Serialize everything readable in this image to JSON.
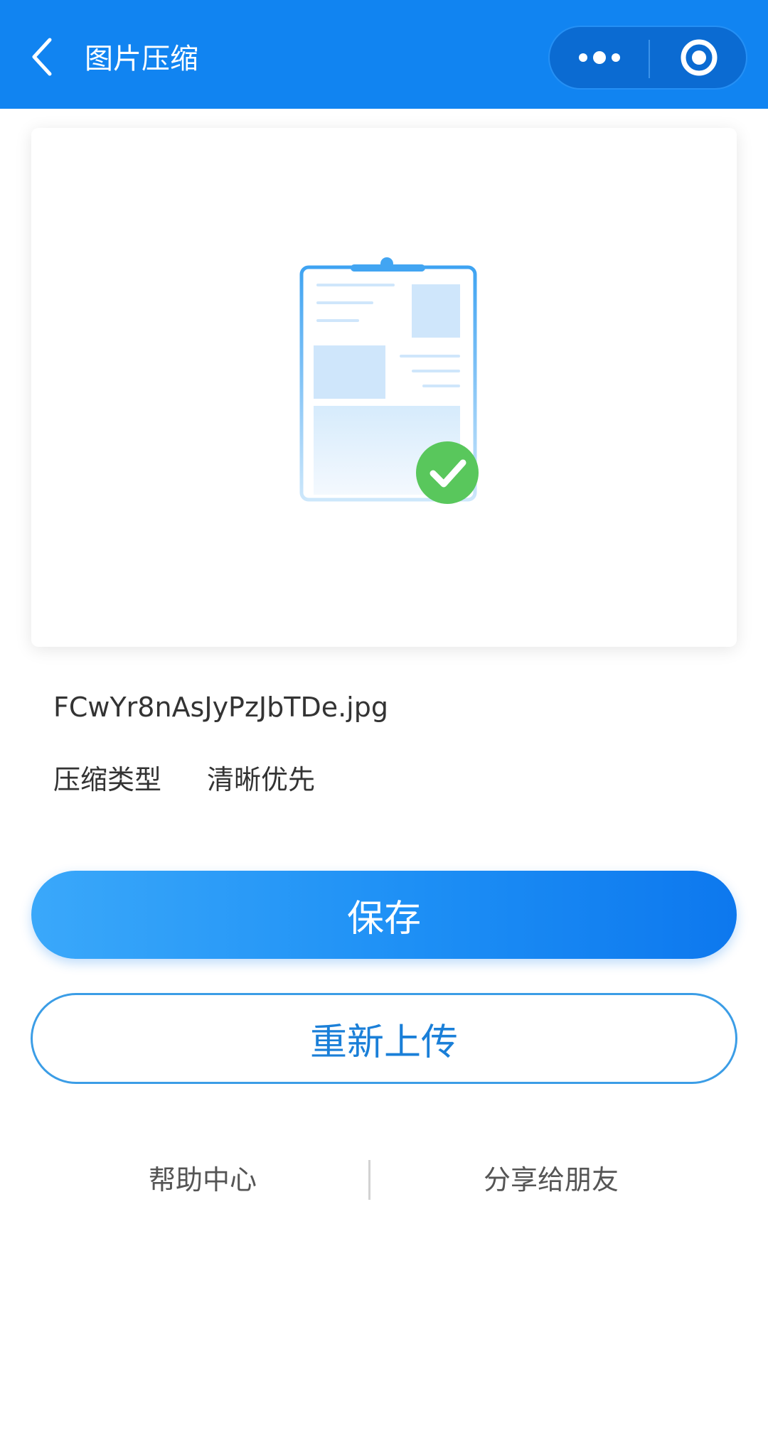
{
  "header": {
    "title": "图片压缩",
    "back_icon": "chevron-left-icon",
    "more_icon": "more-dots-icon",
    "close_icon": "target-circle-icon",
    "background_color": "#1184f1"
  },
  "preview": {
    "illustration_icon": "clipboard-document-check-icon",
    "status_icon": "green-checkmark-icon",
    "status_color": "#59c75c"
  },
  "file": {
    "name": "FCwYr8nAsJyPzJbTDe.jpg",
    "type_label": "压缩类型",
    "type_value": "清晰优先"
  },
  "actions": {
    "save_label": "保存",
    "reupload_label": "重新上传"
  },
  "footer_links": {
    "help": "帮助中心",
    "share": "分享给朋友"
  }
}
